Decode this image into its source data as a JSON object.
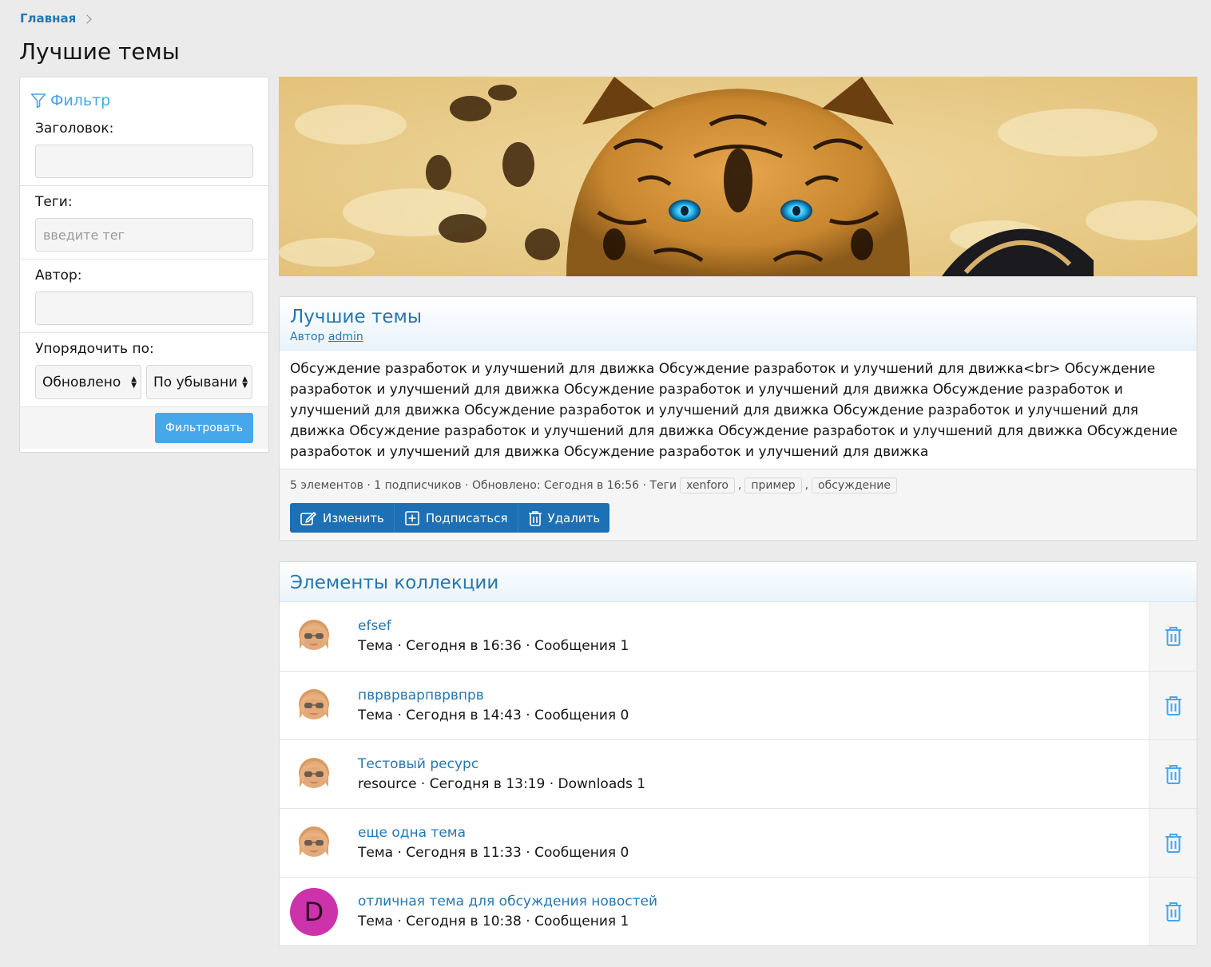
{
  "breadcrumb": {
    "home": "Главная"
  },
  "page": {
    "title": "Лучшие темы"
  },
  "filter": {
    "title": "Фильтр",
    "title_label": "Заголовок:",
    "title_value": "",
    "tags_label": "Теги:",
    "tags_placeholder": "введите тег",
    "author_label": "Автор:",
    "author_value": "",
    "order_label": "Упорядочить по:",
    "order_field": "Обновлено",
    "order_direction": "По убывани",
    "submit": "Фильтровать"
  },
  "collection": {
    "title": "Лучшие темы",
    "author_prefix": "Автор",
    "author": "admin",
    "description": "Обсуждение разработок и улучшений для движка Обсуждение разработок и улучшений для движка<br> Обсуждение разработок и улучшений для движка Обсуждение разработок и улучшений для движка Обсуждение разработок и улучшений для движка Обсуждение разработок и улучшений для движка Обсуждение разработок и улучшений для движка Обсуждение разработок и улучшений для движка Обсуждение разработок и улучшений для движка Обсуждение разработок и улучшений для движка Обсуждение разработок и улучшений для движка",
    "meta": "5 элементов · 1 подписчиков · Обновлено: Сегодня в 16:56 · Теги",
    "tags": [
      "xenforo",
      "пример",
      "обсуждение"
    ],
    "tag_sep": ",",
    "buttons": {
      "edit": "Изменить",
      "subscribe": "Подписаться",
      "delete": "Удалить"
    }
  },
  "items_block": {
    "title": "Элементы коллекции",
    "items": [
      {
        "title": "efsef",
        "meta": "Тема · Сегодня в 16:36 · Сообщения 1",
        "avatar": "memoji"
      },
      {
        "title": "пврврварпврвпрв",
        "meta": "Тема · Сегодня в 14:43 · Сообщения 0",
        "avatar": "memoji"
      },
      {
        "title": "Тестовый ресурс",
        "meta": "resource · Сегодня в 13:19 · Downloads 1",
        "avatar": "memoji"
      },
      {
        "title": "еще одна тема",
        "meta": "Тема · Сегодня в 11:33 · Сообщения 0",
        "avatar": "memoji"
      },
      {
        "title": "отличная тема для обсуждения новостей",
        "meta": "Тема · Сегодня в 10:38 · Сообщения 1",
        "avatar": "D"
      }
    ]
  },
  "colors": {
    "link": "#2577b1",
    "accent": "#47a7eb",
    "button": "#1d70b3",
    "avatar_letter_bg": "#cc33aa"
  }
}
